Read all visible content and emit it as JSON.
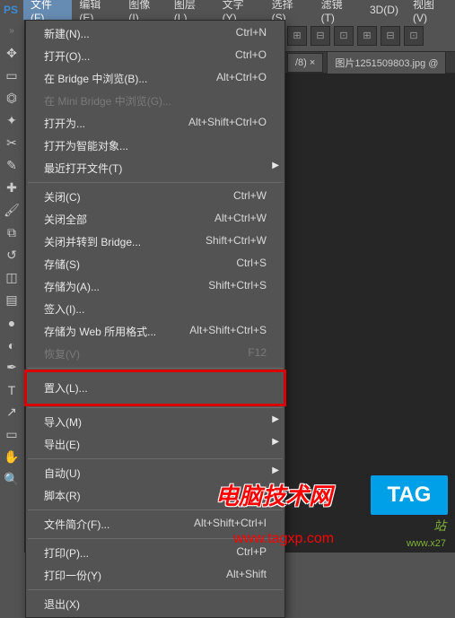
{
  "app_icon": "PS",
  "menubar": [
    {
      "label": "文件(F)",
      "active": true
    },
    {
      "label": "编辑(E)",
      "active": false
    },
    {
      "label": "图像(I)",
      "active": false
    },
    {
      "label": "图层(L)",
      "active": false
    },
    {
      "label": "文字(Y)",
      "active": false
    },
    {
      "label": "选择(S)",
      "active": false
    },
    {
      "label": "滤镜(T)",
      "active": false
    },
    {
      "label": "3D(D)",
      "active": false
    },
    {
      "label": "视图(V)",
      "active": false
    }
  ],
  "document_tabs": {
    "tab1_suffix": "/8) ×",
    "tab2": "图片1251509803.jpg @"
  },
  "file_menu": [
    {
      "label": "新建(N)...",
      "shortcut": "Ctrl+N"
    },
    {
      "label": "打开(O)...",
      "shortcut": "Ctrl+O"
    },
    {
      "label": "在 Bridge 中浏览(B)...",
      "shortcut": "Alt+Ctrl+O"
    },
    {
      "label": "在 Mini Bridge 中浏览(G)...",
      "shortcut": "",
      "disabled": true
    },
    {
      "label": "打开为...",
      "shortcut": "Alt+Shift+Ctrl+O"
    },
    {
      "label": "打开为智能对象..."
    },
    {
      "label": "最近打开文件(T)",
      "submenu": true
    },
    {
      "sep": true
    },
    {
      "label": "关闭(C)",
      "shortcut": "Ctrl+W"
    },
    {
      "label": "关闭全部",
      "shortcut": "Alt+Ctrl+W"
    },
    {
      "label": "关闭并转到 Bridge...",
      "shortcut": "Shift+Ctrl+W"
    },
    {
      "label": "存储(S)",
      "shortcut": "Ctrl+S"
    },
    {
      "label": "存储为(A)...",
      "shortcut": "Shift+Ctrl+S"
    },
    {
      "label": "签入(I)..."
    },
    {
      "label": "存储为 Web 所用格式...",
      "shortcut": "Alt+Shift+Ctrl+S"
    },
    {
      "label": "恢复(V)",
      "shortcut": "F12",
      "disabled": true
    },
    {
      "sep": true
    },
    {
      "label": "置入(L)...",
      "highlighted": true
    },
    {
      "sep": true
    },
    {
      "label": "导入(M)",
      "submenu": true
    },
    {
      "label": "导出(E)",
      "submenu": true
    },
    {
      "sep": true
    },
    {
      "label": "自动(U)",
      "submenu": true
    },
    {
      "label": "脚本(R)",
      "submenu": true
    },
    {
      "sep": true
    },
    {
      "label": "文件简介(F)...",
      "shortcut": "Alt+Shift+Ctrl+I"
    },
    {
      "sep": true
    },
    {
      "label": "打印(P)...",
      "shortcut": "Ctrl+P"
    },
    {
      "label": "打印一份(Y)",
      "shortcut": "Alt+Shift"
    },
    {
      "sep": true
    },
    {
      "label": "退出(X)"
    }
  ],
  "watermark": {
    "text": "电脑技术网",
    "url": "www.tagxp.com",
    "tag_label": "TAG",
    "tag_sub": "站",
    "tag_url": "www.x27"
  }
}
